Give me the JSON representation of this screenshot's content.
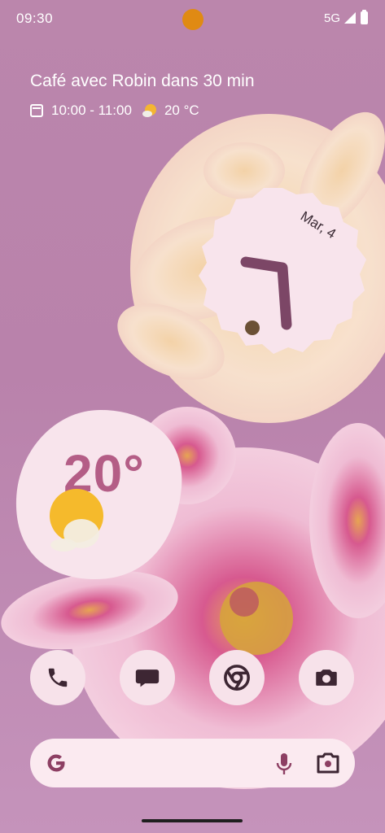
{
  "status": {
    "time": "09:30",
    "network": "5G"
  },
  "glance": {
    "event": "Café avec Robin dans 30 min",
    "time_range": "10:00 - 11:00",
    "temperature": "20 °C"
  },
  "clock": {
    "date": "Mar, 4",
    "icon": "analog-clock-face"
  },
  "weather_widget": {
    "temperature": "20°",
    "icon": "partly-sunny-icon"
  },
  "dock": [
    {
      "icon": "phone-icon",
      "app": "Phone"
    },
    {
      "icon": "messages-icon",
      "app": "Messages"
    },
    {
      "icon": "chrome-icon",
      "app": "Chrome"
    },
    {
      "icon": "camera-icon",
      "app": "Camera"
    }
  ],
  "search": {
    "logo": "google-g-logo",
    "mic": "mic-icon",
    "lens": "lens-icon"
  },
  "colors": {
    "accent": "#b45d86",
    "wallpaper": "#bb86ac",
    "clock_face": "#f8e4ec"
  }
}
